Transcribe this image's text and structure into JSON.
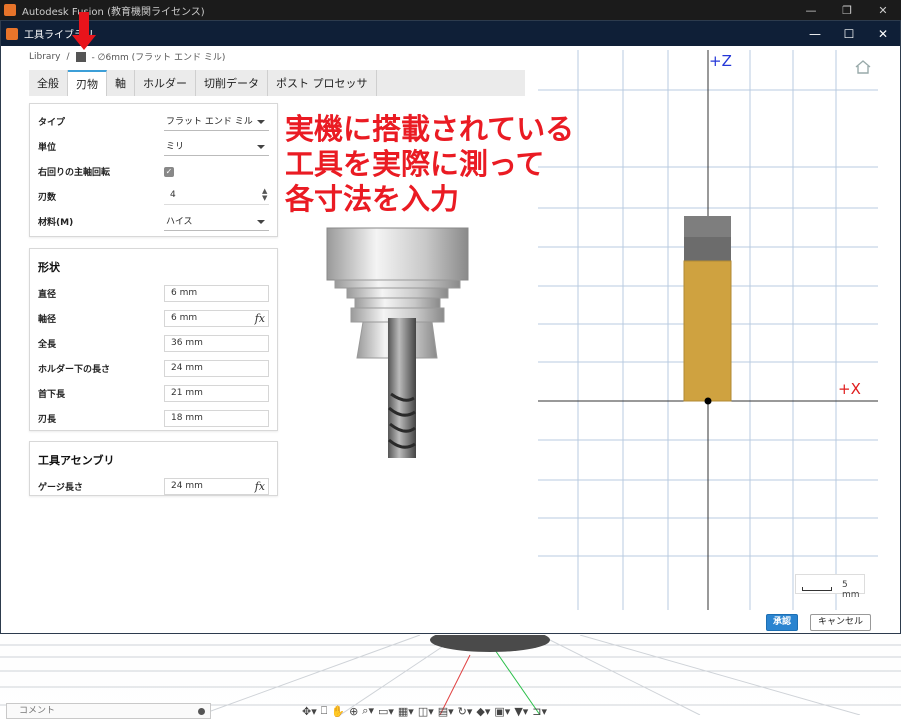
{
  "app": {
    "title": "Autodesk Fusion (教育機関ライセンス)",
    "controls": [
      "—",
      "❐",
      "✕"
    ]
  },
  "dialog": {
    "title": "工具ライブラリ",
    "controls": [
      "—",
      "☐",
      "✕"
    ]
  },
  "breadcrumb": {
    "root": "Library",
    "separator": "/",
    "tool": "- ∅6mm (フラット エンド ミル)"
  },
  "tabs": [
    {
      "label": "全般"
    },
    {
      "label": "刃物"
    },
    {
      "label": "軸"
    },
    {
      "label": "ホルダー"
    },
    {
      "label": "切削データ"
    },
    {
      "label": "ポスト プロセッサ"
    }
  ],
  "general_section": {
    "rows": [
      {
        "label": "タイプ",
        "value": "フラット エンド ミル"
      },
      {
        "label": "単位",
        "value": "ミリ"
      },
      {
        "label": "右回りの主軸回転",
        "value": "✓"
      },
      {
        "label": "刃数",
        "value": "4"
      },
      {
        "label": "材料(M)",
        "value": "ハイス"
      }
    ]
  },
  "shape_section": {
    "title": "形状",
    "rows": [
      {
        "label": "直径",
        "value": "6 mm"
      },
      {
        "label": "軸径",
        "value": "6 mm"
      },
      {
        "label": "全長",
        "value": "36 mm"
      },
      {
        "label": "ホルダー下の長さ",
        "value": "24 mm"
      },
      {
        "label": "首下長",
        "value": "21 mm"
      },
      {
        "label": "刃長",
        "value": "18 mm"
      }
    ]
  },
  "assembly_section": {
    "title": "工具アセンブリ",
    "rows": [
      {
        "label": "ゲージ長さ",
        "value": "24 mm"
      }
    ]
  },
  "fx_symbol": "fx",
  "annotation": {
    "lines": [
      "実機に搭載されている",
      "工具を実際に測って",
      "各寸法を入力"
    ],
    "color": "#ea1b23"
  },
  "viewer": {
    "z_axis_label": "+Z",
    "x_axis_label": "+X",
    "scale_label": "5 mm"
  },
  "buttons": {
    "ok": "承認",
    "cancel": "キャンセル"
  },
  "comment_bar": {
    "label": "コメント"
  },
  "colors": {
    "dialog_titlebar": "#0f1f37",
    "tab_active_accent": "#3c9fd8",
    "ok_button": "#2a84d0",
    "tool_flute": "#d4a443",
    "tool_shank": "#777777"
  }
}
